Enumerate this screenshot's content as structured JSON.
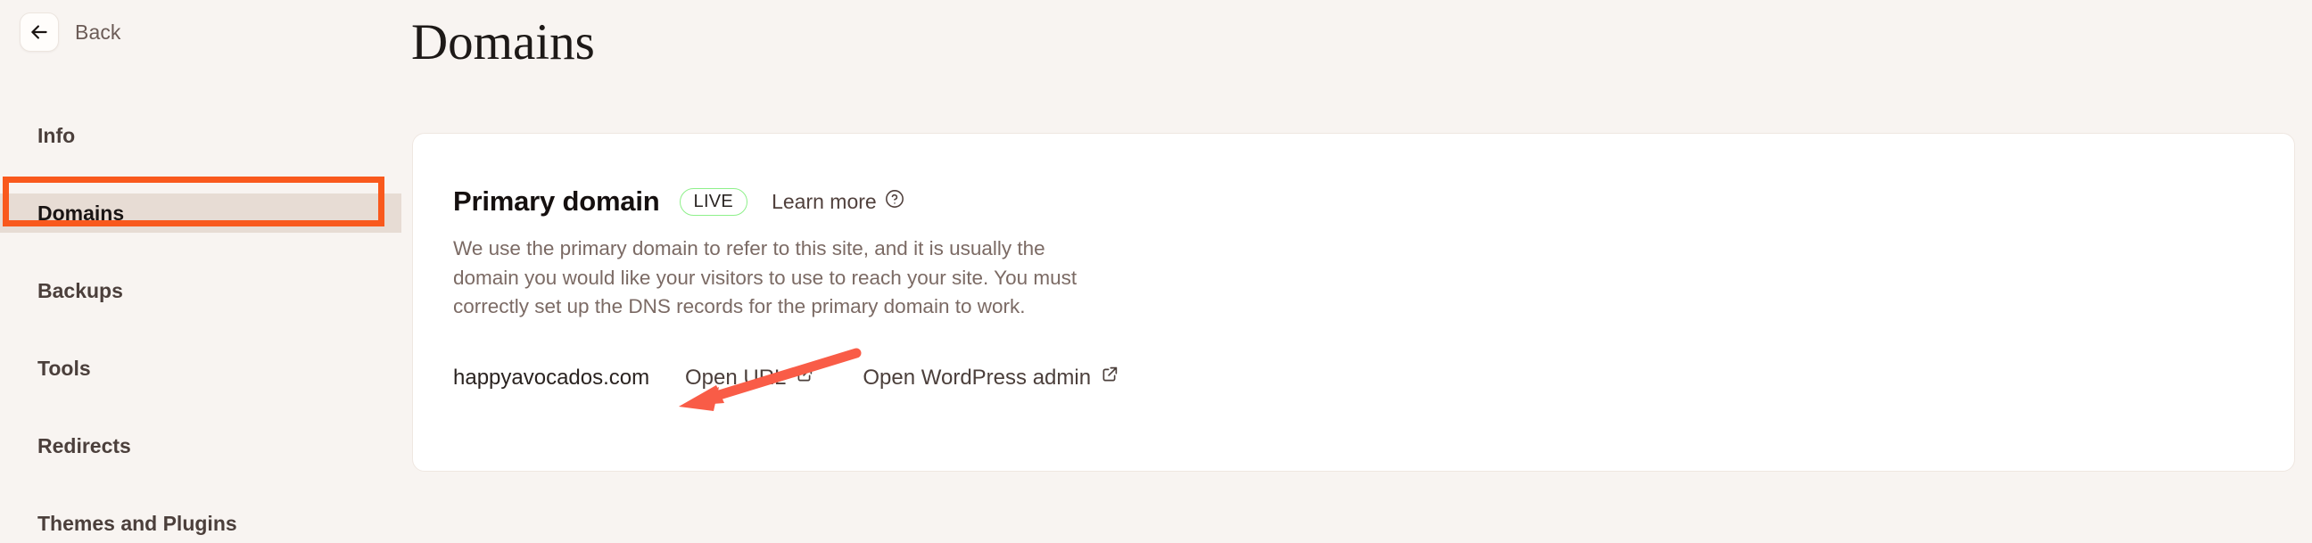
{
  "sidebar": {
    "back": {
      "label": "Back",
      "icon": "arrow-left-icon"
    },
    "items": [
      {
        "label": "Info",
        "active": false
      },
      {
        "label": "Domains",
        "active": true
      },
      {
        "label": "Backups",
        "active": false
      },
      {
        "label": "Tools",
        "active": false
      },
      {
        "label": "Redirects",
        "active": false
      },
      {
        "label": "Themes and Plugins",
        "active": false
      }
    ]
  },
  "main": {
    "page_title": "Domains",
    "card": {
      "title": "Primary domain",
      "status_badge": "LIVE",
      "learn_more": "Learn more",
      "help_icon": "question-circle-icon",
      "description_lines": [
        "We use the primary domain to refer to this site, and it is usually the",
        "domain you would like your visitors to use to reach your site. You must",
        "correctly set up the DNS records for the primary domain to work."
      ],
      "domain_name": "happyavocados.com",
      "links": [
        {
          "label": "Open URL",
          "icon": "external-link-icon"
        },
        {
          "label": "Open WordPress admin",
          "icon": "external-link-icon"
        }
      ]
    }
  },
  "annotation": {
    "arrow_color": "#f95c47",
    "highlight_color": "#f9591d",
    "target": "Domains sidebar item and happyavocados.com domain name"
  },
  "colors": {
    "page_background": "#f8f4f1",
    "card_background": "#ffffff",
    "active_nav_background": "#e7dcd4",
    "badge_border": "#8ef08a",
    "accent_orange": "#f9591d",
    "text_primary": "#1d1917",
    "text_muted": "#7b6a64"
  }
}
